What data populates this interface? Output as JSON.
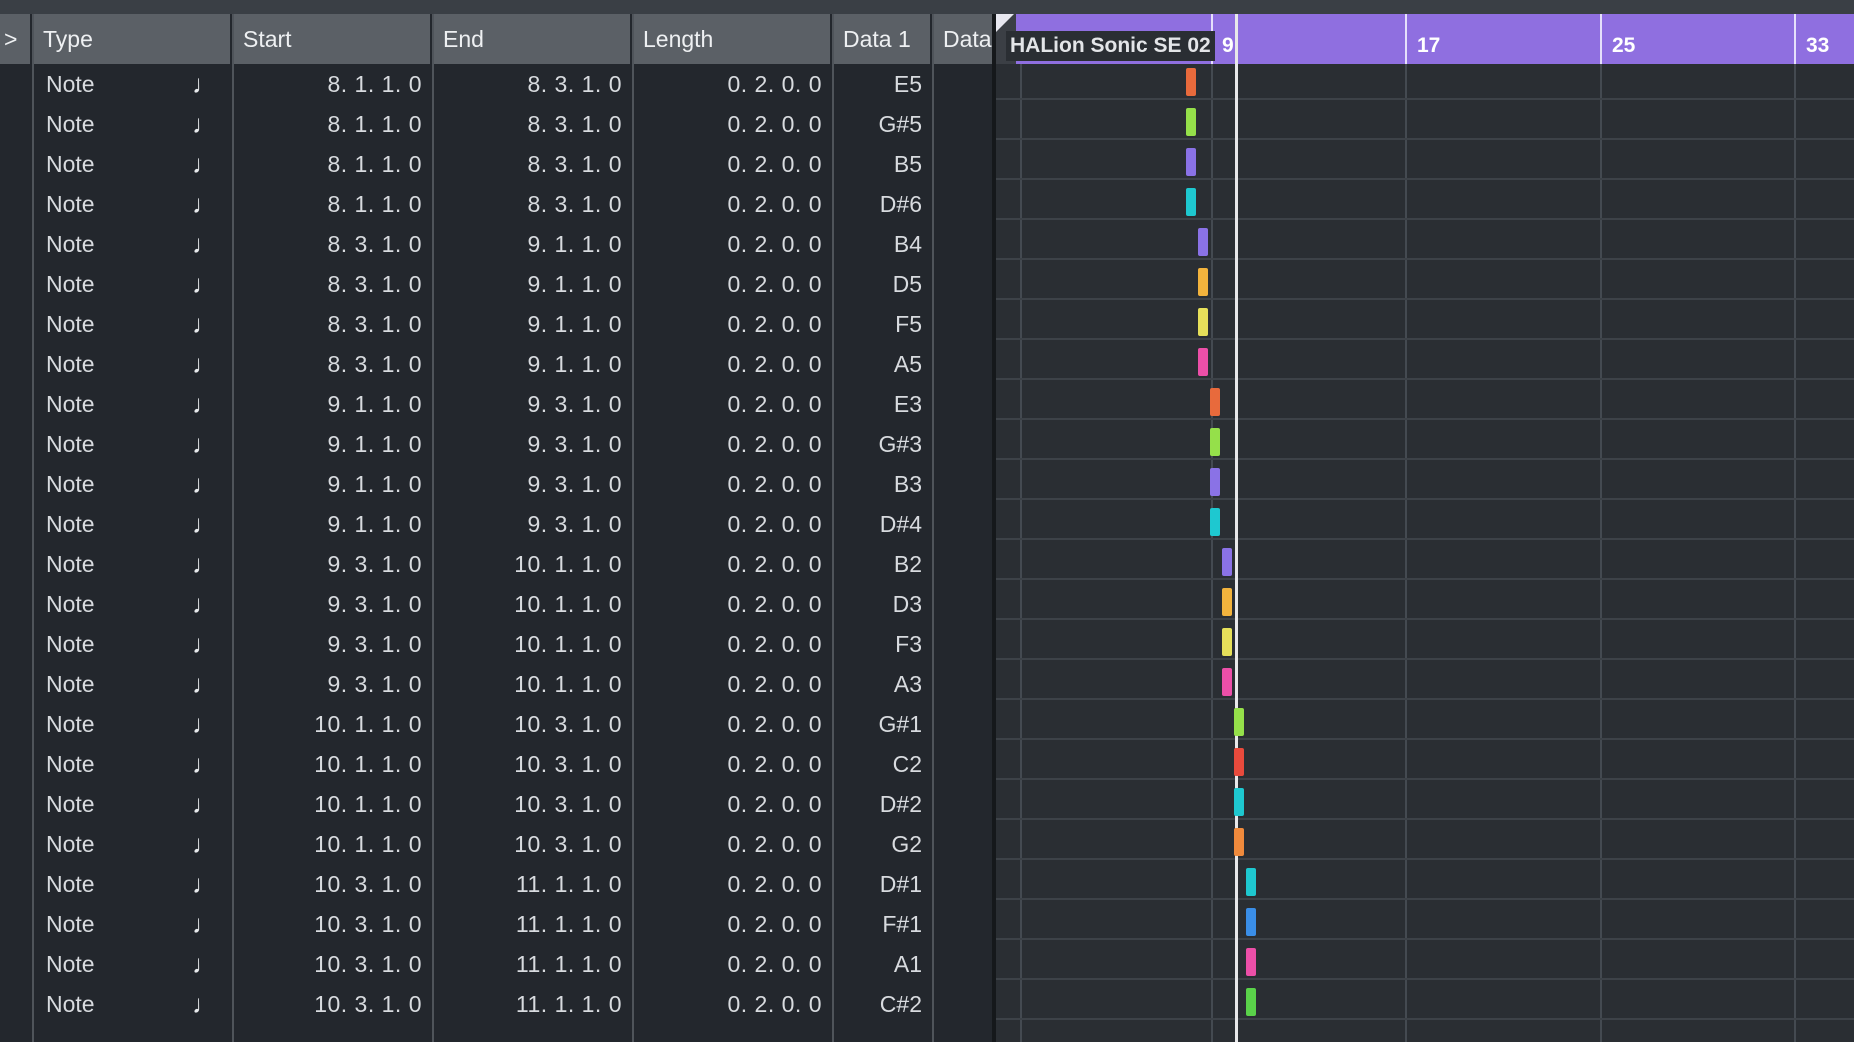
{
  "header": {
    "expander": ">",
    "type": "Type",
    "start": "Start",
    "end": "End",
    "length": "Length",
    "data1": "Data 1",
    "data2": "Data"
  },
  "ruler": {
    "event_label": "HALion Sonic SE 02",
    "bars": [
      "9",
      "17",
      "25",
      "33"
    ]
  },
  "rows": [
    {
      "type": "Note",
      "start": "8. 1. 1. 0",
      "end": "8. 3. 1. 0",
      "length": "0. 2. 0. 0",
      "data1": "E5",
      "color": "#e86a3c",
      "bar": 8.0
    },
    {
      "type": "Note",
      "start": "8. 1. 1. 0",
      "end": "8. 3. 1. 0",
      "length": "0. 2. 0. 0",
      "data1": "G#5",
      "color": "#95e04a",
      "bar": 8.0
    },
    {
      "type": "Note",
      "start": "8. 1. 1. 0",
      "end": "8. 3. 1. 0",
      "length": "0. 2. 0. 0",
      "data1": "B5",
      "color": "#8a72e6",
      "bar": 8.0
    },
    {
      "type": "Note",
      "start": "8. 1. 1. 0",
      "end": "8. 3. 1. 0",
      "length": "0. 2. 0. 0",
      "data1": "D#6",
      "color": "#1ec8d0",
      "bar": 8.0
    },
    {
      "type": "Note",
      "start": "8. 3. 1. 0",
      "end": "9. 1. 1. 0",
      "length": "0. 2. 0. 0",
      "data1": "B4",
      "color": "#8a72e6",
      "bar": 8.5
    },
    {
      "type": "Note",
      "start": "8. 3. 1. 0",
      "end": "9. 1. 1. 0",
      "length": "0. 2. 0. 0",
      "data1": "D5",
      "color": "#f2b33d",
      "bar": 8.5
    },
    {
      "type": "Note",
      "start": "8. 3. 1. 0",
      "end": "9. 1. 1. 0",
      "length": "0. 2. 0. 0",
      "data1": "F5",
      "color": "#e6e05a",
      "bar": 8.5
    },
    {
      "type": "Note",
      "start": "8. 3. 1. 0",
      "end": "9. 1. 1. 0",
      "length": "0. 2. 0. 0",
      "data1": "A5",
      "color": "#ec4fa8",
      "bar": 8.5
    },
    {
      "type": "Note",
      "start": "9. 1. 1. 0",
      "end": "9. 3. 1. 0",
      "length": "0. 2. 0. 0",
      "data1": "E3",
      "color": "#e86a3c",
      "bar": 9.0
    },
    {
      "type": "Note",
      "start": "9. 1. 1. 0",
      "end": "9. 3. 1. 0",
      "length": "0. 2. 0. 0",
      "data1": "G#3",
      "color": "#95e04a",
      "bar": 9.0
    },
    {
      "type": "Note",
      "start": "9. 1. 1. 0",
      "end": "9. 3. 1. 0",
      "length": "0. 2. 0. 0",
      "data1": "B3",
      "color": "#8a72e6",
      "bar": 9.0
    },
    {
      "type": "Note",
      "start": "9. 1. 1. 0",
      "end": "9. 3. 1. 0",
      "length": "0. 2. 0. 0",
      "data1": "D#4",
      "color": "#1ec8d0",
      "bar": 9.0
    },
    {
      "type": "Note",
      "start": "9. 3. 1. 0",
      "end": "10. 1. 1. 0",
      "length": "0. 2. 0. 0",
      "data1": "B2",
      "color": "#8a72e6",
      "bar": 9.5
    },
    {
      "type": "Note",
      "start": "9. 3. 1. 0",
      "end": "10. 1. 1. 0",
      "length": "0. 2. 0. 0",
      "data1": "D3",
      "color": "#f2b33d",
      "bar": 9.5
    },
    {
      "type": "Note",
      "start": "9. 3. 1. 0",
      "end": "10. 1. 1. 0",
      "length": "0. 2. 0. 0",
      "data1": "F3",
      "color": "#e6e05a",
      "bar": 9.5
    },
    {
      "type": "Note",
      "start": "9. 3. 1. 0",
      "end": "10. 1. 1. 0",
      "length": "0. 2. 0. 0",
      "data1": "A3",
      "color": "#ec4fa8",
      "bar": 9.5
    },
    {
      "type": "Note",
      "start": "10. 1. 1. 0",
      "end": "10. 3. 1. 0",
      "length": "0. 2. 0. 0",
      "data1": "G#1",
      "color": "#95e04a",
      "bar": 10.0
    },
    {
      "type": "Note",
      "start": "10. 1. 1. 0",
      "end": "10. 3. 1. 0",
      "length": "0. 2. 0. 0",
      "data1": "C2",
      "color": "#e84a3c",
      "bar": 10.0
    },
    {
      "type": "Note",
      "start": "10. 1. 1. 0",
      "end": "10. 3. 1. 0",
      "length": "0. 2. 0. 0",
      "data1": "D#2",
      "color": "#1ec8d0",
      "bar": 10.0
    },
    {
      "type": "Note",
      "start": "10. 1. 1. 0",
      "end": "10. 3. 1. 0",
      "length": "0. 2. 0. 0",
      "data1": "G2",
      "color": "#f08a3c",
      "bar": 10.0
    },
    {
      "type": "Note",
      "start": "10. 3. 1. 0",
      "end": "11. 1. 1. 0",
      "length": "0. 2. 0. 0",
      "data1": "D#1",
      "color": "#1ec8d0",
      "bar": 10.5
    },
    {
      "type": "Note",
      "start": "10. 3. 1. 0",
      "end": "11. 1. 1. 0",
      "length": "0. 2. 0. 0",
      "data1": "F#1",
      "color": "#3a8ee8",
      "bar": 10.5
    },
    {
      "type": "Note",
      "start": "10. 3. 1. 0",
      "end": "11. 1. 1. 0",
      "length": "0. 2. 0. 0",
      "data1": "A1",
      "color": "#ec4fa8",
      "bar": 10.5
    },
    {
      "type": "Note",
      "start": "10. 3. 1. 0",
      "end": "11. 1. 1. 0",
      "length": "0. 2. 0. 0",
      "data1": "C#2",
      "color": "#5ad24a",
      "bar": 10.5
    }
  ]
}
